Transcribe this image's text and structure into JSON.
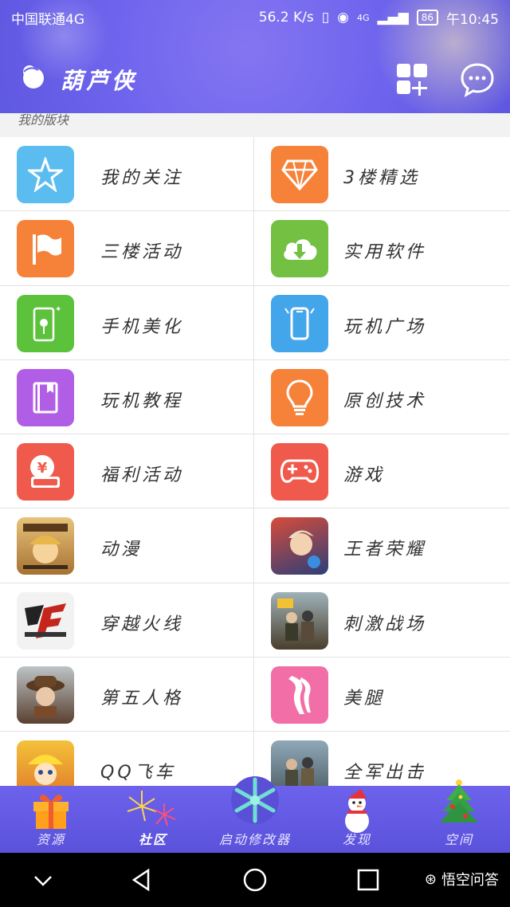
{
  "status_bar": {
    "carrier": "中国联通4G",
    "speed": "56.2 K/s",
    "network": "4G",
    "battery": "86",
    "time": "午10:45"
  },
  "header": {
    "app_name": "葫芦侠"
  },
  "section_label": "我的版块",
  "boards": [
    {
      "label": "我的关注",
      "icon": "star-icon",
      "color": "#5bbcf0"
    },
    {
      "label": "3楼精选",
      "icon": "diamond-icon",
      "color": "#f6823a"
    },
    {
      "label": "三楼活动",
      "icon": "flag-icon",
      "color": "#f6823a"
    },
    {
      "label": "实用软件",
      "icon": "cloud-download-icon",
      "color": "#74c043"
    },
    {
      "label": "手机美化",
      "icon": "phone-flower-icon",
      "color": "#5dc23b"
    },
    {
      "label": "玩机广场",
      "icon": "phone-icon",
      "color": "#44a6ea"
    },
    {
      "label": "玩机教程",
      "icon": "book-icon",
      "color": "#b15ee6"
    },
    {
      "label": "原创技术",
      "icon": "lightbulb-icon",
      "color": "#f6823a"
    },
    {
      "label": "福利活动",
      "icon": "gift-yuan-icon",
      "color": "#f05a4c"
    },
    {
      "label": "游戏",
      "icon": "gamepad-icon",
      "color": "#f05a4c"
    },
    {
      "label": "动漫",
      "icon": "anime-thumbnail",
      "color": "#c79a4a"
    },
    {
      "label": "王者荣耀",
      "icon": "honor-of-kings-thumbnail",
      "color": "#3a4b86"
    },
    {
      "label": "穿越火线",
      "icon": "crossfire-thumbnail",
      "color": "#dcdcdc"
    },
    {
      "label": "刺激战场",
      "icon": "pubg-thumbnail",
      "color": "#6b5a3e"
    },
    {
      "label": "第五人格",
      "icon": "identity-v-thumbnail",
      "color": "#7a5a44"
    },
    {
      "label": "美腿",
      "icon": "legs-icon",
      "color": "#f26ea7"
    },
    {
      "label": "QQ飞车",
      "icon": "qq-speed-thumbnail",
      "color": "#f4c23a"
    },
    {
      "label": "全军出击",
      "icon": "pubg-exhilarating-thumbnail",
      "color": "#556b7a"
    }
  ],
  "bottom_nav": [
    {
      "label": "资源",
      "icon": "gift-icon"
    },
    {
      "label": "社区",
      "icon": "firework-icon"
    },
    {
      "label": "启动修改器",
      "icon": "snowflake-icon"
    },
    {
      "label": "发现",
      "icon": "snowman-icon"
    },
    {
      "label": "空间",
      "icon": "christmas-tree-icon"
    }
  ],
  "watermark": "悟空问答"
}
